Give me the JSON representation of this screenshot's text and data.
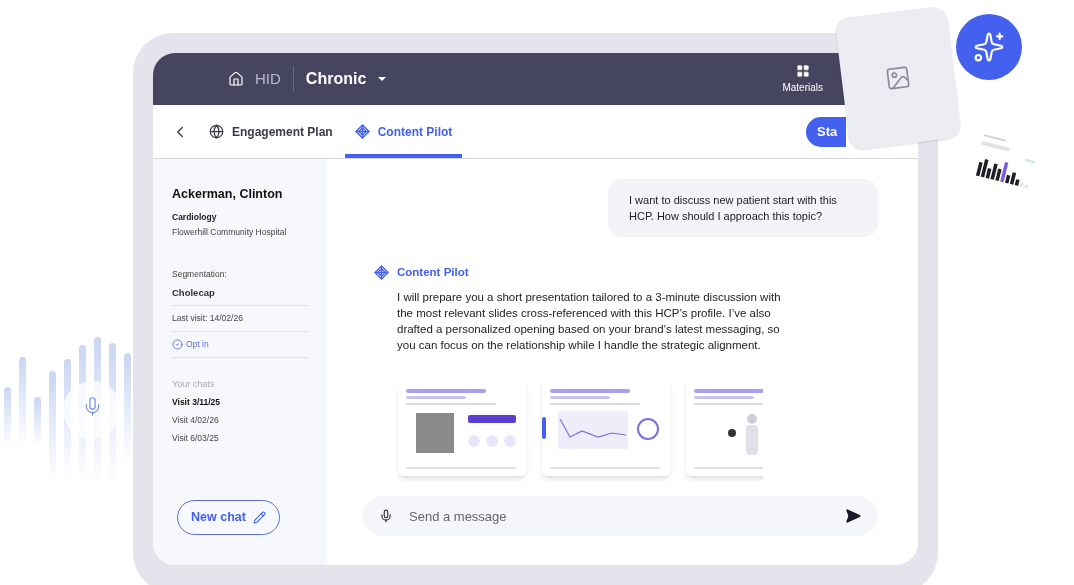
{
  "header": {
    "home_label": "HID",
    "product": "Chronic",
    "materials_label": "Materials"
  },
  "tabs": [
    {
      "label": "Engagement Plan",
      "selected": false,
      "kind": "globe"
    },
    {
      "label": "Content Pilot",
      "selected": true,
      "kind": "pilot"
    }
  ],
  "start_button": "Sta",
  "profile": {
    "name": "Ackerman, Clinton",
    "specialty": "Cardiology",
    "hospital": "Flowerhill Community Hospital",
    "segmentation_label": "Segmentation:",
    "segmentation": "Cholecap",
    "last_visit": "Last visit: 14/02/26",
    "opt_in": {
      "label": "Opt in",
      "checked": true
    }
  },
  "chats": {
    "heading": "Your chats",
    "items": [
      {
        "label": "Visit 3/11/25",
        "selected": true
      },
      {
        "label": "Visit 4/02/26",
        "selected": false
      },
      {
        "label": "Visit 6/03/25",
        "selected": false
      }
    ]
  },
  "new_chat": "New chat",
  "messages": [
    {
      "kind": "user",
      "text": "I want to discuss new patient start with this HCP. How should I approach this topic?"
    },
    {
      "kind": "assistant",
      "sender": "Content Pilot",
      "text": "I will prepare you a short presentation tailored to a 3-minute discussion with the most relevant slides cross-referenced with this HCP’s profile. I’ve also drafted a personalized opening based on your brand’s latest messaging, so you can focus on the relationship while I handle the strategic alignment."
    }
  ],
  "composer": {
    "placeholder": "Send a message"
  }
}
